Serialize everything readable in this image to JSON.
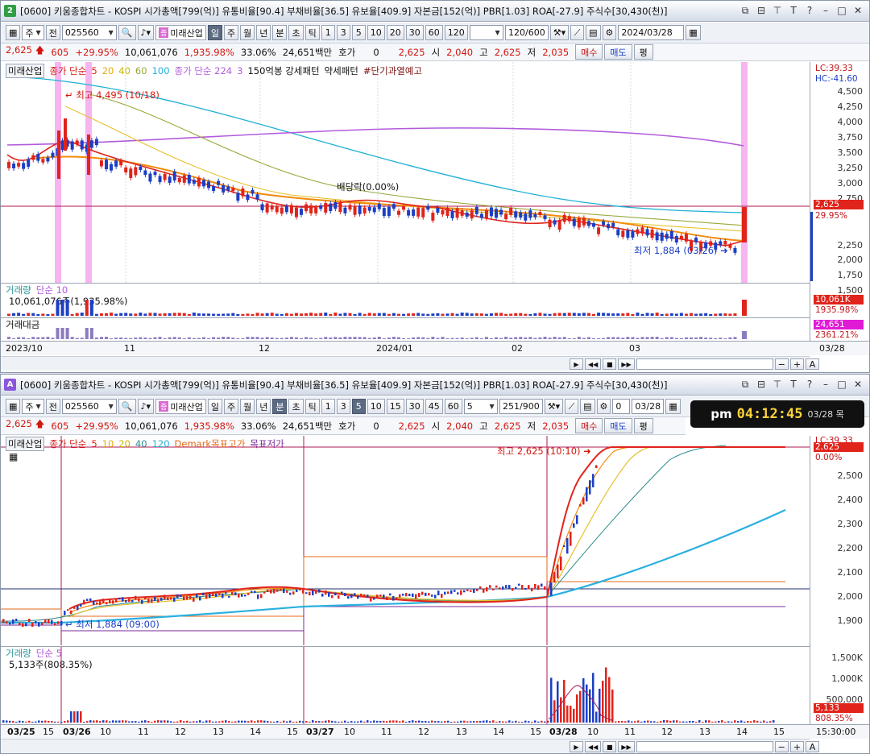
{
  "pane1": {
    "badge": "2",
    "title": "[0600] 키움종합차트 - KOSPI 시가총액[799(억)] 유통비율[90.4] 부채비율[36.5] 유보율[409.9] 자본금[152(억)] PBR[1.03] ROA[-27.9] 주식수[30,430(천)]",
    "toolbar": {
      "market": "주",
      "jeon": "전",
      "code": "025560",
      "name": "미래산업",
      "periods": [
        "일",
        "주",
        "월",
        "년",
        "분",
        "초",
        "틱"
      ],
      "active_period": "일",
      "intervals": [
        "1",
        "3",
        "5",
        "10",
        "20",
        "30",
        "60",
        "120"
      ],
      "count": "120/600",
      "date": "2024/03/28"
    },
    "quote": {
      "price": "2,625",
      "change": "605",
      "change_pct": "+29.95%",
      "volume": "10,061,076",
      "vol_ratio": "1,935.98%",
      "turnover": "33.06%",
      "amount": "24,651백만",
      "hoga": "호가",
      "hoga_val": "0",
      "last": "2,625",
      "open_lbl": "시",
      "open": "2,040",
      "high_lbl": "고",
      "high": "2,625",
      "low_lbl": "저",
      "low": "2,035",
      "buy": "매수",
      "sell": "매도",
      "eval": "평"
    },
    "legend": {
      "name": "미래산업",
      "ma_lbl": "종가 단순",
      "ma": [
        "5",
        "20",
        "40",
        "60",
        "100"
      ],
      "ma2_lbl": "종가 단순 224",
      "ma2_n": "3",
      "pattern": "150억봉 강세패턴",
      "weak": "약세패턴",
      "warn": "#단기과열예고"
    },
    "annotations": {
      "high": "최고 4,495 (10/18)",
      "dividend": "배당락(0.00%)",
      "low": "최저 1,884 (03/26)"
    },
    "yaxis": {
      "lc": "LC:39.33",
      "hc": "HC:-41.60",
      "ticks": [
        "4,500",
        "4,250",
        "4,000",
        "3,750",
        "3,500",
        "3,250",
        "3,000",
        "2,750",
        "2,500",
        "2,250",
        "2,000",
        "1,750",
        "1,500"
      ],
      "price_tag": "2,625",
      "pct_tag": "29.95%"
    },
    "volume": {
      "label": "거래량",
      "ma_lbl": "단순 10",
      "value": "10,061,076주(1,935.98%)",
      "tag": "10,061K",
      "tag_pct": "1935.98%"
    },
    "amount": {
      "label": "거래대금",
      "tag": "24,651",
      "tag_pct": "2361.21%"
    },
    "xaxis": {
      "labels": [
        "2023/10",
        "11",
        "12",
        "2024/01",
        "02",
        "03"
      ],
      "end": "03/28"
    },
    "colors": {
      "up": "#e0241b",
      "down": "#1c3fc4",
      "ma5": "#e0241b",
      "ma20": "#f28a0c",
      "ma40": "#e6c12b",
      "ma60": "#9aa83a",
      "ma100": "#1fb0d6",
      "ma224": "#b35bdc",
      "highlight": "#f7b5f0"
    }
  },
  "pane2": {
    "badge": "A",
    "title": "[0600] 키움종합차트 - KOSPI 시가총액[799(억)] 유통비율[90.4] 부채비율[36.5] 유보율[409.9] 자본금[152(억)] PBR[1.03] ROA[-27.9] 주식수[30,430(천)]",
    "toolbar": {
      "market": "주",
      "jeon": "전",
      "code": "025560",
      "name": "미래산업",
      "periods": [
        "일",
        "주",
        "월",
        "년",
        "분",
        "초",
        "틱"
      ],
      "active_period": "분",
      "intervals": [
        "1",
        "3",
        "5",
        "10",
        "15",
        "30",
        "45",
        "60"
      ],
      "active_interval": "5",
      "interval_val": "5",
      "count": "251/900",
      "chk": "0",
      "date": "03/28"
    },
    "quote": {
      "price": "2,625",
      "change": "605",
      "change_pct": "+29.95%",
      "volume": "10,061,076",
      "vol_ratio": "1,935.98%",
      "turnover": "33.06%",
      "amount": "24,651백만",
      "hoga": "호가",
      "hoga_val": "0",
      "last": "2,625",
      "open_lbl": "시",
      "open": "2,040",
      "high_lbl": "고",
      "high": "2,625",
      "low_lbl": "저",
      "low": "2,035",
      "buy": "매수",
      "sell": "매도",
      "eval": "평"
    },
    "clock": {
      "ampm": "pm",
      "time": "04:12:45",
      "date": "03/28 목"
    },
    "legend": {
      "name": "미래산업",
      "ma_lbl": "종가 단순",
      "ma": [
        "5",
        "10",
        "20",
        "40",
        "120"
      ],
      "demark": "Demark목표고가",
      "demark_low": "목표저가"
    },
    "annotations": {
      "high": "최고 2,625 (10:10)",
      "low": "최저 1,884 (09:00)"
    },
    "yaxis": {
      "lc": "LC:39.33",
      "ticks": [
        "2,500",
        "2,400",
        "2,300",
        "2,200",
        "2,100",
        "2,000",
        "1,900"
      ],
      "price_tag": "2,625",
      "pct_tag": "0.00%"
    },
    "volume": {
      "label": "거래량",
      "ma_lbl": "단순 5",
      "value": "5,133주(808.35%)",
      "ticks": [
        "1,500K",
        "1,000K",
        "500,000"
      ],
      "tag": "5,133",
      "tag_pct": "808.35%"
    },
    "xaxis": {
      "labels": [
        "03/25",
        "15",
        "03/26",
        "10",
        "11",
        "12",
        "13",
        "14",
        "15",
        "03/27",
        "10",
        "11",
        "12",
        "13",
        "14",
        "15",
        "03/28",
        "10",
        "11",
        "12",
        "13",
        "14",
        "15"
      ],
      "end": "15:30:00"
    }
  }
}
